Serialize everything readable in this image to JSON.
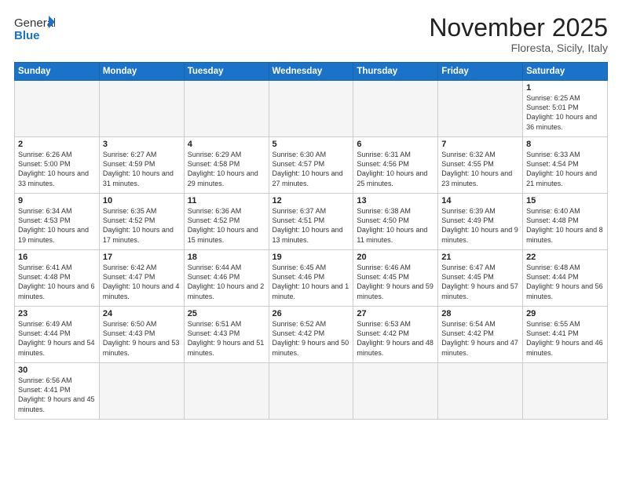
{
  "header": {
    "logo_general": "General",
    "logo_blue": "Blue",
    "month_title": "November 2025",
    "subtitle": "Floresta, Sicily, Italy"
  },
  "weekdays": [
    "Sunday",
    "Monday",
    "Tuesday",
    "Wednesday",
    "Thursday",
    "Friday",
    "Saturday"
  ],
  "weeks": [
    [
      {
        "day": "",
        "info": ""
      },
      {
        "day": "",
        "info": ""
      },
      {
        "day": "",
        "info": ""
      },
      {
        "day": "",
        "info": ""
      },
      {
        "day": "",
        "info": ""
      },
      {
        "day": "",
        "info": ""
      },
      {
        "day": "1",
        "info": "Sunrise: 6:25 AM\nSunset: 5:01 PM\nDaylight: 10 hours and 36 minutes."
      }
    ],
    [
      {
        "day": "2",
        "info": "Sunrise: 6:26 AM\nSunset: 5:00 PM\nDaylight: 10 hours and 33 minutes."
      },
      {
        "day": "3",
        "info": "Sunrise: 6:27 AM\nSunset: 4:59 PM\nDaylight: 10 hours and 31 minutes."
      },
      {
        "day": "4",
        "info": "Sunrise: 6:29 AM\nSunset: 4:58 PM\nDaylight: 10 hours and 29 minutes."
      },
      {
        "day": "5",
        "info": "Sunrise: 6:30 AM\nSunset: 4:57 PM\nDaylight: 10 hours and 27 minutes."
      },
      {
        "day": "6",
        "info": "Sunrise: 6:31 AM\nSunset: 4:56 PM\nDaylight: 10 hours and 25 minutes."
      },
      {
        "day": "7",
        "info": "Sunrise: 6:32 AM\nSunset: 4:55 PM\nDaylight: 10 hours and 23 minutes."
      },
      {
        "day": "8",
        "info": "Sunrise: 6:33 AM\nSunset: 4:54 PM\nDaylight: 10 hours and 21 minutes."
      }
    ],
    [
      {
        "day": "9",
        "info": "Sunrise: 6:34 AM\nSunset: 4:53 PM\nDaylight: 10 hours and 19 minutes."
      },
      {
        "day": "10",
        "info": "Sunrise: 6:35 AM\nSunset: 4:52 PM\nDaylight: 10 hours and 17 minutes."
      },
      {
        "day": "11",
        "info": "Sunrise: 6:36 AM\nSunset: 4:52 PM\nDaylight: 10 hours and 15 minutes."
      },
      {
        "day": "12",
        "info": "Sunrise: 6:37 AM\nSunset: 4:51 PM\nDaylight: 10 hours and 13 minutes."
      },
      {
        "day": "13",
        "info": "Sunrise: 6:38 AM\nSunset: 4:50 PM\nDaylight: 10 hours and 11 minutes."
      },
      {
        "day": "14",
        "info": "Sunrise: 6:39 AM\nSunset: 4:49 PM\nDaylight: 10 hours and 9 minutes."
      },
      {
        "day": "15",
        "info": "Sunrise: 6:40 AM\nSunset: 4:48 PM\nDaylight: 10 hours and 8 minutes."
      }
    ],
    [
      {
        "day": "16",
        "info": "Sunrise: 6:41 AM\nSunset: 4:48 PM\nDaylight: 10 hours and 6 minutes."
      },
      {
        "day": "17",
        "info": "Sunrise: 6:42 AM\nSunset: 4:47 PM\nDaylight: 10 hours and 4 minutes."
      },
      {
        "day": "18",
        "info": "Sunrise: 6:44 AM\nSunset: 4:46 PM\nDaylight: 10 hours and 2 minutes."
      },
      {
        "day": "19",
        "info": "Sunrise: 6:45 AM\nSunset: 4:46 PM\nDaylight: 10 hours and 1 minute."
      },
      {
        "day": "20",
        "info": "Sunrise: 6:46 AM\nSunset: 4:45 PM\nDaylight: 9 hours and 59 minutes."
      },
      {
        "day": "21",
        "info": "Sunrise: 6:47 AM\nSunset: 4:45 PM\nDaylight: 9 hours and 57 minutes."
      },
      {
        "day": "22",
        "info": "Sunrise: 6:48 AM\nSunset: 4:44 PM\nDaylight: 9 hours and 56 minutes."
      }
    ],
    [
      {
        "day": "23",
        "info": "Sunrise: 6:49 AM\nSunset: 4:44 PM\nDaylight: 9 hours and 54 minutes."
      },
      {
        "day": "24",
        "info": "Sunrise: 6:50 AM\nSunset: 4:43 PM\nDaylight: 9 hours and 53 minutes."
      },
      {
        "day": "25",
        "info": "Sunrise: 6:51 AM\nSunset: 4:43 PM\nDaylight: 9 hours and 51 minutes."
      },
      {
        "day": "26",
        "info": "Sunrise: 6:52 AM\nSunset: 4:42 PM\nDaylight: 9 hours and 50 minutes."
      },
      {
        "day": "27",
        "info": "Sunrise: 6:53 AM\nSunset: 4:42 PM\nDaylight: 9 hours and 48 minutes."
      },
      {
        "day": "28",
        "info": "Sunrise: 6:54 AM\nSunset: 4:42 PM\nDaylight: 9 hours and 47 minutes."
      },
      {
        "day": "29",
        "info": "Sunrise: 6:55 AM\nSunset: 4:41 PM\nDaylight: 9 hours and 46 minutes."
      }
    ],
    [
      {
        "day": "30",
        "info": "Sunrise: 6:56 AM\nSunset: 4:41 PM\nDaylight: 9 hours and 45 minutes."
      },
      {
        "day": "",
        "info": ""
      },
      {
        "day": "",
        "info": ""
      },
      {
        "day": "",
        "info": ""
      },
      {
        "day": "",
        "info": ""
      },
      {
        "day": "",
        "info": ""
      },
      {
        "day": "",
        "info": ""
      }
    ]
  ]
}
